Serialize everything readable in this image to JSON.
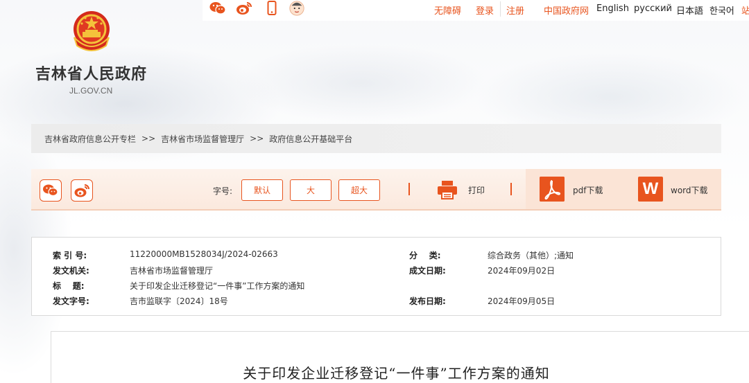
{
  "header": {
    "site_name": "吉林省人民政府",
    "site_domain": "JL.GOV.CN",
    "top_links": {
      "accessibility": "无障碍",
      "login": "登录",
      "register": "注册",
      "china_gov": "中国政府网",
      "english": "English",
      "russian": "русский",
      "japanese": "日本語",
      "korean": "한국어",
      "site": "站"
    },
    "social_icons": [
      "wechat-icon",
      "weibo-icon",
      "mobile-icon",
      "baby-avatar-icon"
    ]
  },
  "breadcrumb": {
    "items": [
      "吉林省政府信息公开专栏",
      "吉林省市场监督管理厅",
      "政府信息公开基础平台"
    ],
    "separator": ">>"
  },
  "toolbar": {
    "font_label": "字号:",
    "font_default": "默认",
    "font_large": "大",
    "font_xlarge": "超大",
    "print": "打印",
    "pdf_download": "pdf下载",
    "word_download": "word下载",
    "word_letter": "W",
    "accent_color": "#e8541e"
  },
  "meta": {
    "index_label": "索 引 号:",
    "index_value": "11220000MB1528034J/2024-02663",
    "category_label": "分    类:",
    "category_value": "综合政务（其他）;通知",
    "issuer_label": "发文机关:",
    "issuer_value": "吉林省市场监督管理厅",
    "date_written_label": "成文日期:",
    "date_written_value": "2024年09月02日",
    "title_label": "标    题:",
    "title_value": "关于印发企业迁移登记“一件事”工作方案的通知",
    "doc_no_label": "发文字号:",
    "doc_no_value": "吉市监联字〔2024〕18号",
    "publish_date_label": "发布日期:",
    "publish_date_value": "2024年09月05日"
  },
  "article": {
    "title": "关于印发企业迁移登记“一件事”工作方案的通知"
  }
}
